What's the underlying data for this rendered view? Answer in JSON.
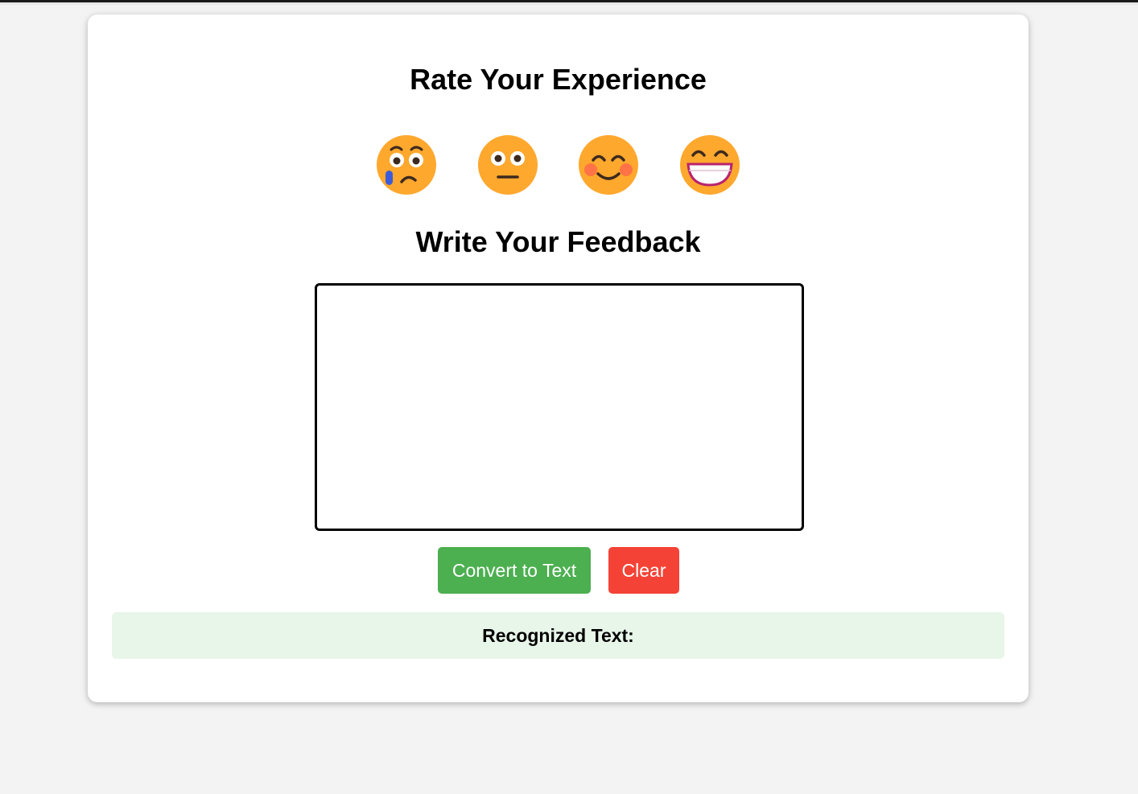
{
  "page": {
    "rating_title": "Rate Your Experience",
    "feedback_title": "Write Your Feedback"
  },
  "emojis": [
    {
      "name": "crying-face-icon",
      "mood": "sad"
    },
    {
      "name": "neutral-face-icon",
      "mood": "neutral"
    },
    {
      "name": "smiling-face-icon",
      "mood": "happy"
    },
    {
      "name": "grinning-face-icon",
      "mood": "very-happy"
    }
  ],
  "buttons": {
    "convert_label": "Convert to Text",
    "clear_label": "Clear"
  },
  "result": {
    "label": "Recognized Text:",
    "text": ""
  },
  "colors": {
    "convert_button": "#4caf50",
    "clear_button": "#f44336",
    "result_background": "#e8f5e9",
    "emoji_face": "#ffa82e"
  }
}
